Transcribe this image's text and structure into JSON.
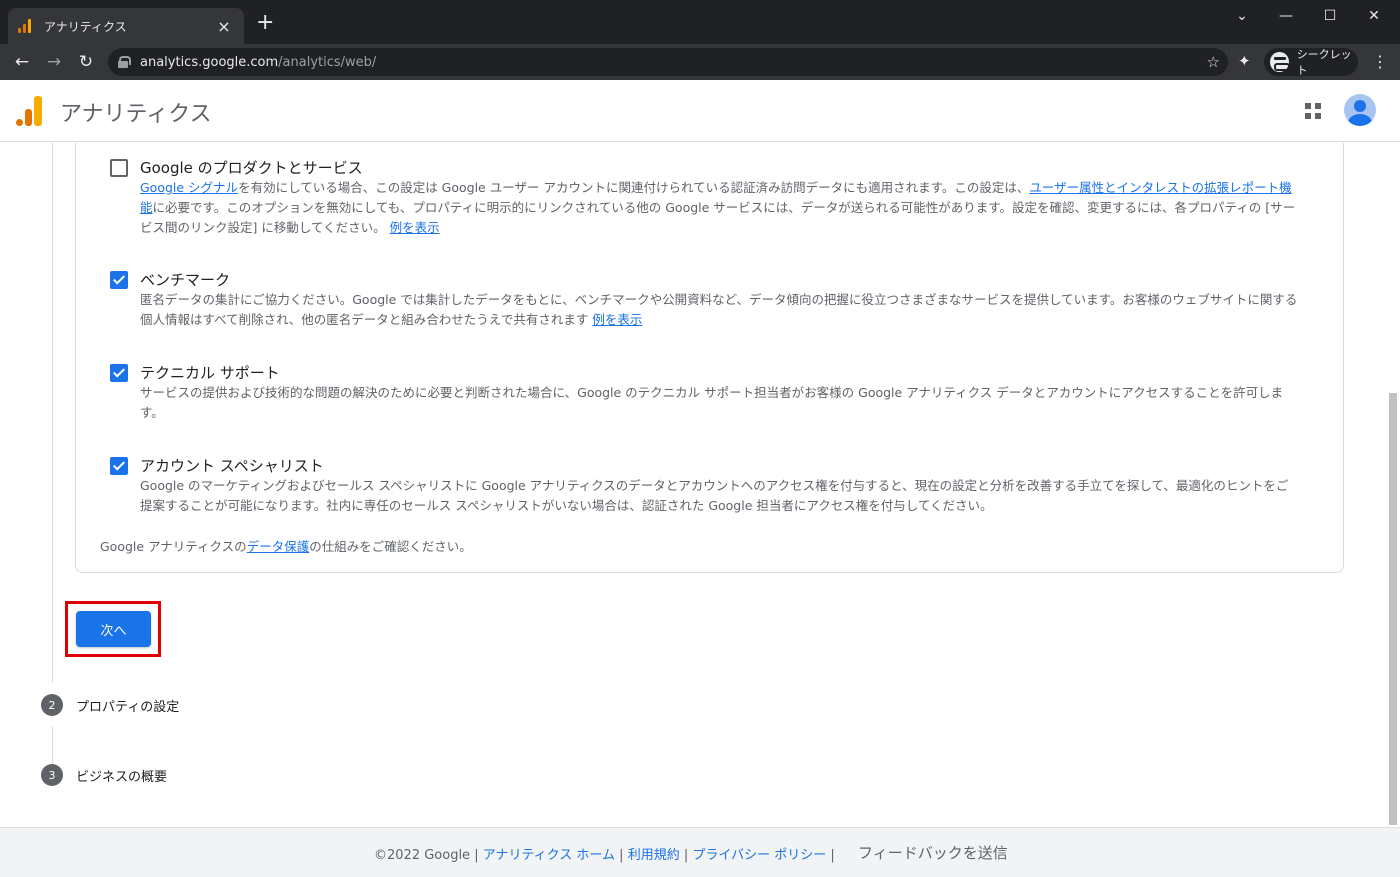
{
  "browser": {
    "tab_title": "アナリティクス",
    "tab_close": "×",
    "new_tab": "+",
    "url_host": "analytics.google.com",
    "url_path": "/analytics/web/",
    "incognito_label": "シークレット",
    "window_controls": [
      "⌄",
      "—",
      "☐",
      "✕"
    ]
  },
  "app": {
    "title": "アナリティクス",
    "logo_colors": [
      "#f9ab00",
      "#e37400",
      "#e37400"
    ]
  },
  "options": [
    {
      "title": "Google のプロダクトとサービス",
      "checked": false,
      "desc_parts": [
        {
          "text": "Google シグナル",
          "link": true
        },
        {
          "text": "を有効にしている場合、この設定は Google ユーザー アカウントに関連付けられている認証済み訪問データにも適用されます。この設定は、",
          "link": false
        },
        {
          "text": "ユーザー属性とインタレストの拡張レポート機能",
          "link": true
        },
        {
          "text": "に必要です。このオプションを無効にしても、プロパティに明示的にリンクされている他の Google サービスには、データが送られる可能性があります。設定を確認、変更するには、各プロパティの [サービス間のリンク設定] に移動してください。 ",
          "link": false
        },
        {
          "text": "例を表示",
          "link": true
        }
      ]
    },
    {
      "title": "ベンチマーク",
      "checked": true,
      "desc_parts": [
        {
          "text": "匿名データの集計にご協力ください。Google では集計したデータをもとに、ベンチマークや公開資料など、データ傾向の把握に役立つさまざまなサービスを提供しています。お客様のウェブサイトに関する個人情報はすべて削除され、他の匿名データと組み合わせたうえで共有されます ",
          "link": false
        },
        {
          "text": "例を表示",
          "link": true
        }
      ]
    },
    {
      "title": "テクニカル サポート",
      "checked": true,
      "desc_parts": [
        {
          "text": "サービスの提供および技術的な問題の解決のために必要と判断された場合に、Google のテクニカル サポート担当者がお客様の Google アナリティクス データとアカウントにアクセスすることを許可します。",
          "link": false
        }
      ]
    },
    {
      "title": "アカウント スペシャリスト",
      "checked": true,
      "desc_parts": [
        {
          "text": "Google のマーケティングおよびセールス スペシャリストに Google アナリティクスのデータとアカウントへのアクセス権を付与すると、現在の設定と分析を改善する手立てを探して、最適化のヒントをご提案することが可能になります。社内に専任のセールス スペシャリストがいない場合は、認証された Google 担当者にアクセス権を付与してください。",
          "link": false
        }
      ]
    }
  ],
  "note": {
    "prefix": "Google アナリティクスの",
    "link": "データ保護",
    "suffix": "の仕組みをご確認ください。"
  },
  "next_button": "次へ",
  "steps": [
    {
      "num": "2",
      "label": "プロパティの設定"
    },
    {
      "num": "3",
      "label": "ビジネスの概要"
    }
  ],
  "footer": {
    "copyright": "©2022 Google | ",
    "links": [
      "アナリティクス ホーム",
      "利用規約",
      "プライバシー ポリシー"
    ],
    "separator": " | ",
    "feedback": "フィードバックを送信"
  }
}
